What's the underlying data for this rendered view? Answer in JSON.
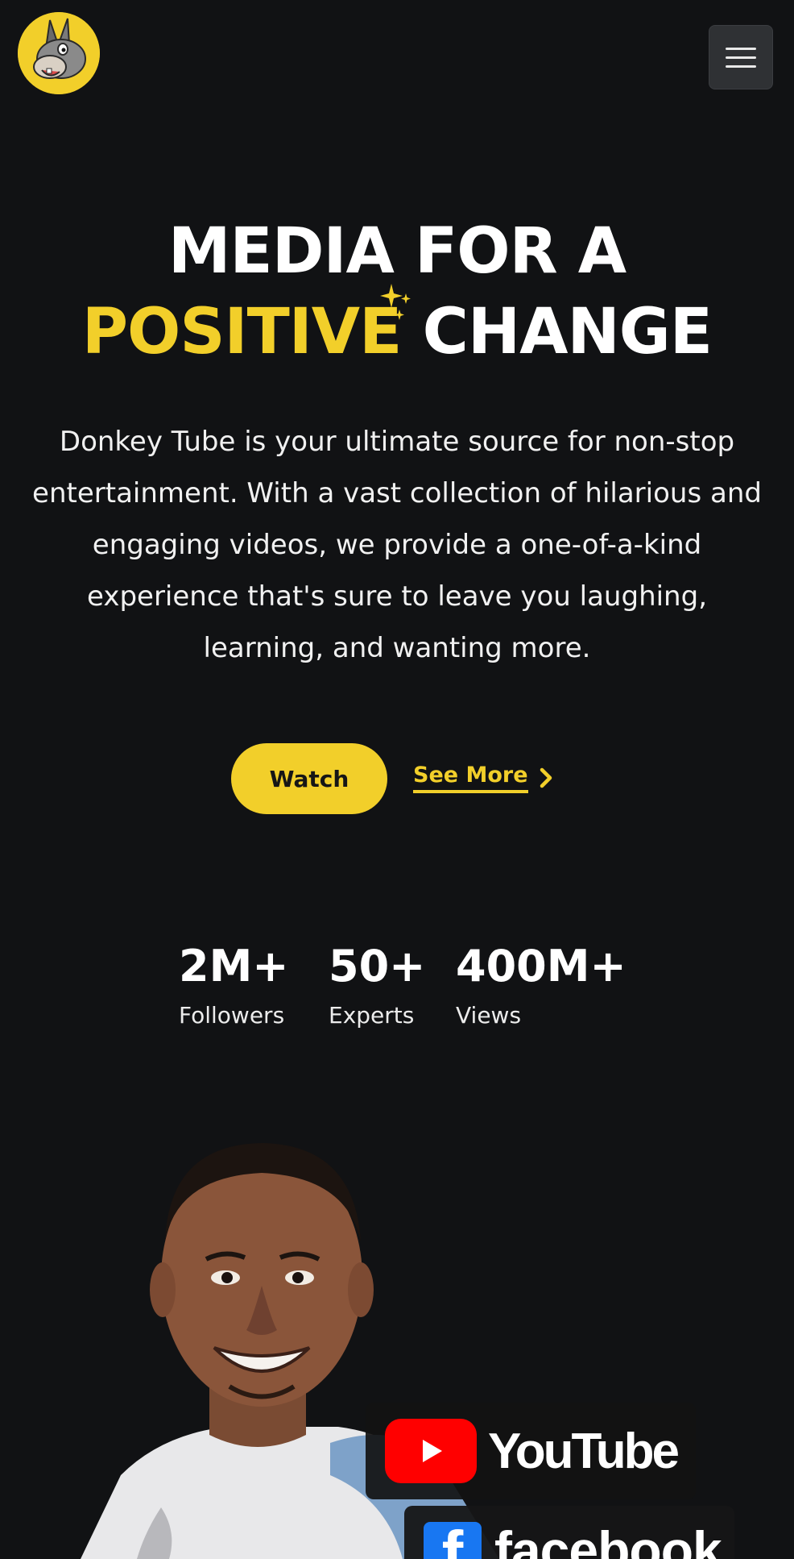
{
  "header": {
    "logo_alt": "Donkey Tube logo",
    "menu_icon": "hamburger-menu-icon"
  },
  "hero": {
    "title_line1": "MEDIA FOR A",
    "title_highlight": "POSITIVE",
    "title_line2_rest": "CHANGE",
    "description": "Donkey Tube is your ultimate source for non-stop entertainment. With a vast collection of hilarious and engaging videos, we provide a one-of-a-kind experience that's sure to leave you laughing, learning, and wanting more.",
    "watch_label": "Watch",
    "see_more_label": "See More"
  },
  "stats": [
    {
      "value": "2M+",
      "label": "Followers"
    },
    {
      "value": "50+",
      "label": "Experts"
    },
    {
      "value": "400M+",
      "label": "Views"
    }
  ],
  "platforms": {
    "youtube": "YouTube",
    "facebook_letter": "f",
    "facebook": "facebook"
  },
  "colors": {
    "accent": "#f2cf2a",
    "background": "#111214",
    "youtube_red": "#ff0000",
    "facebook_blue": "#1877f2"
  }
}
